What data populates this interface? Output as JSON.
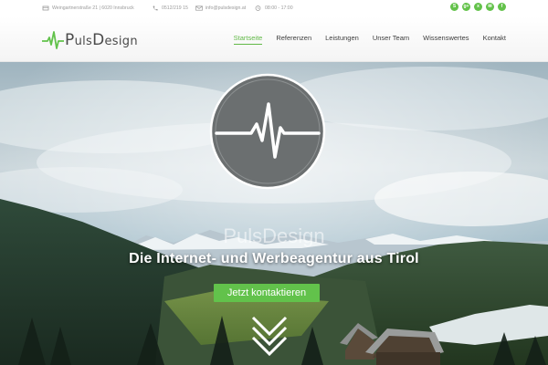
{
  "topbar": {
    "address": "Weingartnerstraße 21 | 6020 Innsbruck",
    "phone": "0512/219 15",
    "email": "info@pulsdesign.at",
    "hours": "08:00 - 17:00",
    "socials": [
      {
        "icon": "skype-icon",
        "glyph": "S"
      },
      {
        "icon": "google-plus-icon",
        "glyph": "g+"
      },
      {
        "icon": "xing-icon",
        "glyph": "x"
      },
      {
        "icon": "email-icon",
        "glyph": "✉"
      },
      {
        "icon": "facebook-icon",
        "glyph": "f"
      }
    ]
  },
  "header": {
    "logo_first": "P",
    "logo_first_rest": "uls",
    "logo_second": "D",
    "logo_second_rest": "esign",
    "nav": [
      "Startseite",
      "Referenzen",
      "Leistungen",
      "Unser Team",
      "Wissenswertes",
      "Kontakt"
    ],
    "active_nav": "Startseite"
  },
  "hero": {
    "title": "PulsDesign",
    "subtitle": "Die Internet- und Werbeagentur aus Tirol",
    "cta_label": "Jetzt kontaktieren"
  },
  "colors": {
    "accent": "#62c24b",
    "text": "#3e3e3e"
  }
}
